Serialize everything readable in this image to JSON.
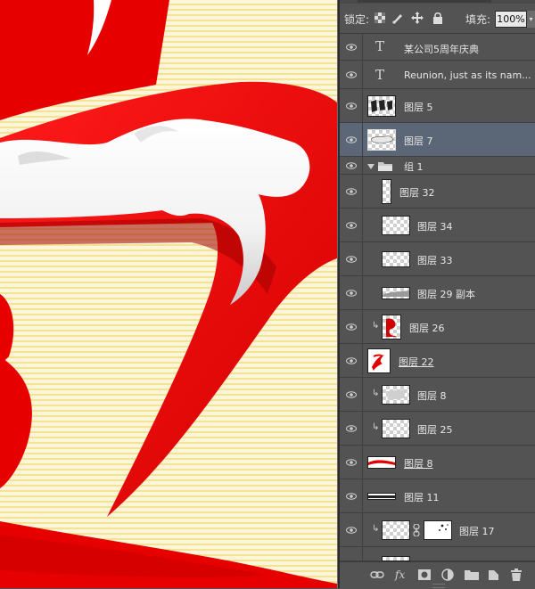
{
  "panel": {
    "lock_label": "锁定:",
    "fill_label": "填充:",
    "fill_value": "100%",
    "lock_icons": [
      "lock-transparent-pixels-icon",
      "lock-image-pixels-icon",
      "lock-position-icon",
      "lock-all-icon"
    ],
    "layers": [
      {
        "name": "某公司5周年庆典",
        "kind": "text"
      },
      {
        "name": "Reunion, just as its nam...",
        "kind": "text"
      },
      {
        "name": "图层 5",
        "kind": "layer"
      },
      {
        "name": "图层 7",
        "kind": "layer",
        "selected": true
      },
      {
        "name": "组 1",
        "kind": "group",
        "expanded": true
      },
      {
        "name": "图层 32",
        "kind": "layer"
      },
      {
        "name": "图层 34",
        "kind": "layer"
      },
      {
        "name": "图层 33",
        "kind": "layer"
      },
      {
        "name": "图层 29 副本",
        "kind": "layer"
      },
      {
        "name": "图层 26",
        "kind": "layer",
        "clipped": true
      },
      {
        "name": "图层 22",
        "kind": "layer",
        "underlined": true
      },
      {
        "name": "图层 8",
        "kind": "layer",
        "clipped": true
      },
      {
        "name": "图层 25",
        "kind": "layer",
        "clipped": true
      },
      {
        "name": "图层 8",
        "kind": "layer",
        "underlined": true
      },
      {
        "name": "图层 11",
        "kind": "layer"
      },
      {
        "name": "图层 17",
        "kind": "layer",
        "clipped": true,
        "mask": true
      }
    ],
    "bottom_icons": [
      "link-layers-icon",
      "fx-icon",
      "add-mask-icon",
      "adjustment-layer-icon",
      "new-group-icon",
      "new-layer-icon",
      "trash-icon"
    ],
    "fx_label": "fx"
  },
  "colors": {
    "canvas_red": "#e80000",
    "canvas_cream": "#fcf6d6",
    "panel_bg": "#535353",
    "selected_row": "#5b6777"
  }
}
